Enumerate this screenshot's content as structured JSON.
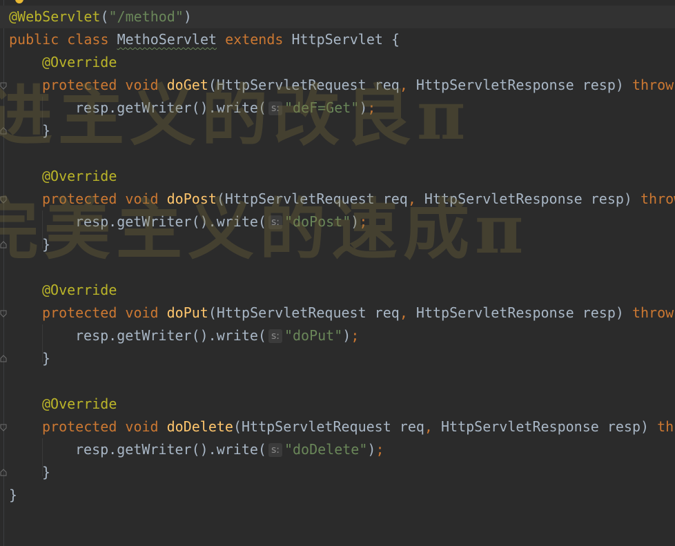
{
  "editor": {
    "lines": {
      "l1": {
        "annotation": "@WebServlet",
        "open": "(",
        "path": "\"/method\"",
        "close": ")"
      },
      "l2": {
        "public": "public",
        "class": "class",
        "name": "MethoServlet",
        "extends": "extends",
        "parent": "HttpServlet",
        "brace": "{"
      },
      "override": "@Override",
      "protected": "protected",
      "void": "void",
      "params_a": "(HttpServletRequest req",
      "comma": ",",
      "params_b": " HttpServletResponse resp) ",
      "throws_full": "throws",
      "throws_partial_a": "throw",
      "throws_partial_b": "thr",
      "call": "resp.getWriter().write(",
      "hint": "s:",
      "close_paren": ")",
      "semicolon": ";",
      "close_brace": "}"
    },
    "methods": {
      "get": {
        "name": "doGet",
        "string": "\"deF=Get\""
      },
      "post": {
        "name": "doPost",
        "string": "\"doPost\""
      },
      "put": {
        "name": "doPut",
        "string": "\"doPut\""
      },
      "delete": {
        "name": "doDelete",
        "string": "\"doDelete\""
      }
    },
    "watermark": {
      "line1": "进主义的改良π",
      "line2": "完美主义的速成π"
    }
  }
}
